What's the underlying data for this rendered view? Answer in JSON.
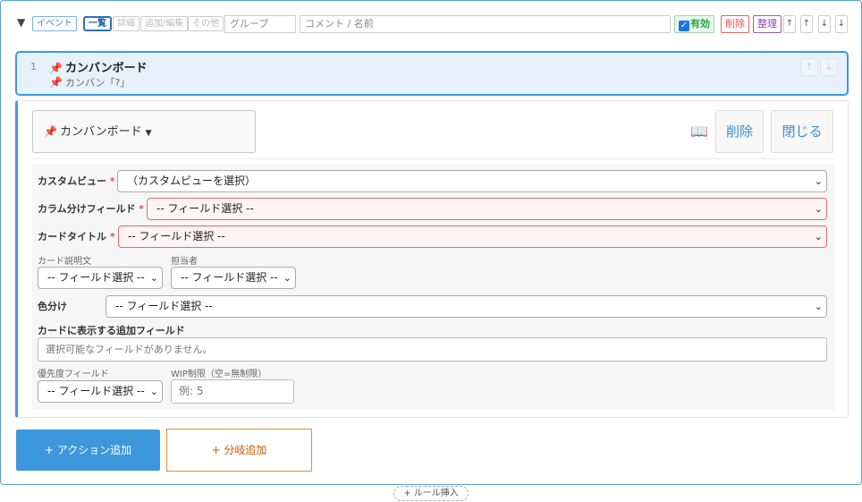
{
  "header": {
    "toggle": "▼",
    "chips": [
      "イベント",
      "一覧",
      "詳細",
      "追加/編集",
      "その他"
    ],
    "group_placeholder": "グループ",
    "comment_placeholder": "コメント / 名前",
    "enabled_label": "有効",
    "enabled_checked": true,
    "delete_label": "削除",
    "organize_label": "整理",
    "arrows": [
      "↑",
      "↑",
      "↓",
      "↓"
    ]
  },
  "item": {
    "number": "1",
    "title": "カンバンボード",
    "subtitle": "カンバン「?」",
    "move_up": "↑",
    "move_down": "↓"
  },
  "editor": {
    "type_label": "カンバンボード",
    "help_icon": "book-icon",
    "delete_label": "削除",
    "close_label": "閉じる",
    "fields": {
      "custom_view": {
        "label": "カスタムビュー",
        "required": "*",
        "value": "（カスタムビューを選択）"
      },
      "column_field": {
        "label": "カラム分けフィールド",
        "required": "*",
        "value": "-- フィールド選択 --"
      },
      "card_title": {
        "label": "カードタイトル",
        "required": "*",
        "value": "-- フィールド選択 --"
      },
      "card_desc": {
        "label": "カード説明文",
        "value": "-- フィールド選択 --"
      },
      "assignee": {
        "label": "担当者",
        "value": "-- フィールド選択 --"
      },
      "color": {
        "label": "色分け",
        "value": "-- フィールド選択 --"
      },
      "extra_fields": {
        "label": "カードに表示する追加フィールド",
        "value": "選択可能なフィールドがありません。"
      },
      "priority": {
        "label": "優先度フィールド",
        "value": "-- フィールド選択 --"
      },
      "wip": {
        "label": "WIP制限（空=無制限）",
        "placeholder": "例: 5"
      }
    }
  },
  "buttons": {
    "add_action": "+ アクション追加",
    "add_branch": "+ 分岐追加",
    "insert_rule": "+ ルール挿入"
  },
  "colors": {
    "accent": "#3b9ae1",
    "error_border": "#e06c6c",
    "enabled": "#29a745",
    "delete": "#d9534f",
    "organize": "#8e44ad",
    "branch": "#d35400"
  }
}
